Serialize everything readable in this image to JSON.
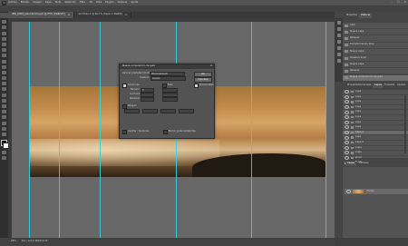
{
  "app": {
    "logo": "Ps"
  },
  "menu": [
    "Archivo",
    "Edición",
    "Imagen",
    "Capa",
    "Texto",
    "Selección",
    "Filtro",
    "3D",
    "Vista",
    "Plugins",
    "Ventana",
    "Ayuda"
  ],
  "window_controls": [
    "–",
    "☐",
    "✕"
  ],
  "tabs": [
    {
      "label": "IMG_0003_panoramica.psd @ 25% (RGB/16*)",
      "close": "×"
    },
    {
      "label": "Sin título-1 @ 66,7% (Capa 1, RGB/8)",
      "close": "×"
    }
  ],
  "dialog": {
    "title": "Nueva composición de guía",
    "close": "✕",
    "preset_label": "Valores predeterminados de la composición:",
    "preset_value": "Personalizado",
    "target_label": "Destino:",
    "target_value": "Lienzo",
    "columns_label": "Columnas",
    "rows_label": "Filas",
    "number_label": "Número",
    "width_label": "Anchura",
    "gutter_label": "Medianil",
    "columns_number": "5",
    "rows_number": "",
    "margin_label": "Margen",
    "margin_fields": [
      "",
      "",
      "",
      ""
    ],
    "center_label": "Centrar columnas",
    "clear_label": "Borrar guías existentes",
    "ok": "OK",
    "cancel": "Cancelar",
    "preview_label": "Previsualizar"
  },
  "panels": {
    "top_tabs": [
      "Muestras",
      "Historia"
    ],
    "history_items": [
      "Abrir",
      "Nueva capa",
      "Rellenar",
      "Transformación libre",
      "Nueva capa",
      "Deseleccionar",
      "Nueva capa",
      "Rellenar",
      "Nueva composición de guía"
    ],
    "layers_tabs": [
      "Propiedades",
      "Canales",
      "Capas",
      "Trazados",
      "Ajustes"
    ],
    "layers": [
      "capa",
      "capa",
      "capa",
      "capa",
      "capa",
      "capa",
      "capa",
      "capa",
      "capa",
      "capa",
      "capa",
      "capa",
      "capa",
      "capa",
      "Capa 1",
      "capa",
      "Capa 2",
      "copia",
      "copia",
      "capa",
      "Fondo",
      "grupo"
    ],
    "bottom_tabs": [
      "Capas",
      "Canales"
    ],
    "bottom_layer": "Fondo"
  },
  "status": {
    "zoom": "25%",
    "doc": "Doc: 111,6 M/223,2 M"
  }
}
